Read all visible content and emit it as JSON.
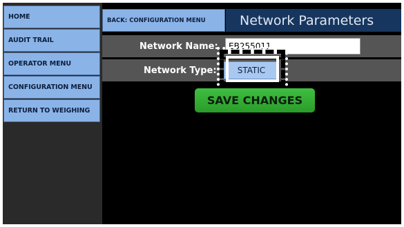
{
  "sidebar": {
    "items": [
      {
        "label": "HOME"
      },
      {
        "label": "AUDIT TRAIL"
      },
      {
        "label": "OPERATOR MENU"
      },
      {
        "label": "CONFIGURATION MENU"
      },
      {
        "label": "RETURN TO WEIGHING"
      }
    ]
  },
  "header": {
    "back_label": "BACK: CONFIGURATION MENU",
    "title": "Network Parameters"
  },
  "form": {
    "network_name": {
      "label": "Network Name:",
      "value": "EB255011"
    },
    "network_type": {
      "label": "Network Type:",
      "value": "STATIC"
    }
  },
  "actions": {
    "save_label": "SAVE CHANGES"
  },
  "colors": {
    "nav_button": "#8ab4e8",
    "title_bar": "#17365f",
    "save_button": "#34ad35",
    "row_background": "#555555"
  }
}
